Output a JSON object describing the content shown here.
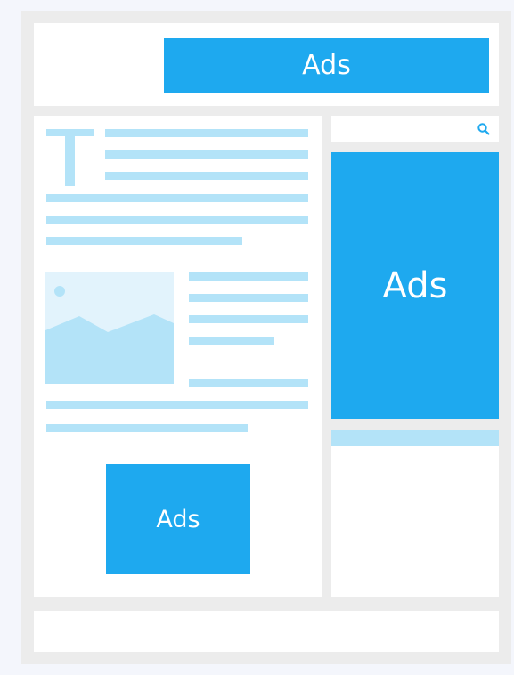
{
  "header": {
    "ad_label": "Ads"
  },
  "sidebar": {
    "ad_label": "Ads"
  },
  "article": {
    "ad_label": "Ads",
    "drop_cap": "T"
  },
  "icons": {
    "search": "search-icon"
  },
  "colors": {
    "ad_blue": "#1ea9ef",
    "text_line": "#b3e3f8",
    "frame": "#ececec",
    "panel": "#ffffff",
    "image_bg": "#e2f3fc"
  }
}
